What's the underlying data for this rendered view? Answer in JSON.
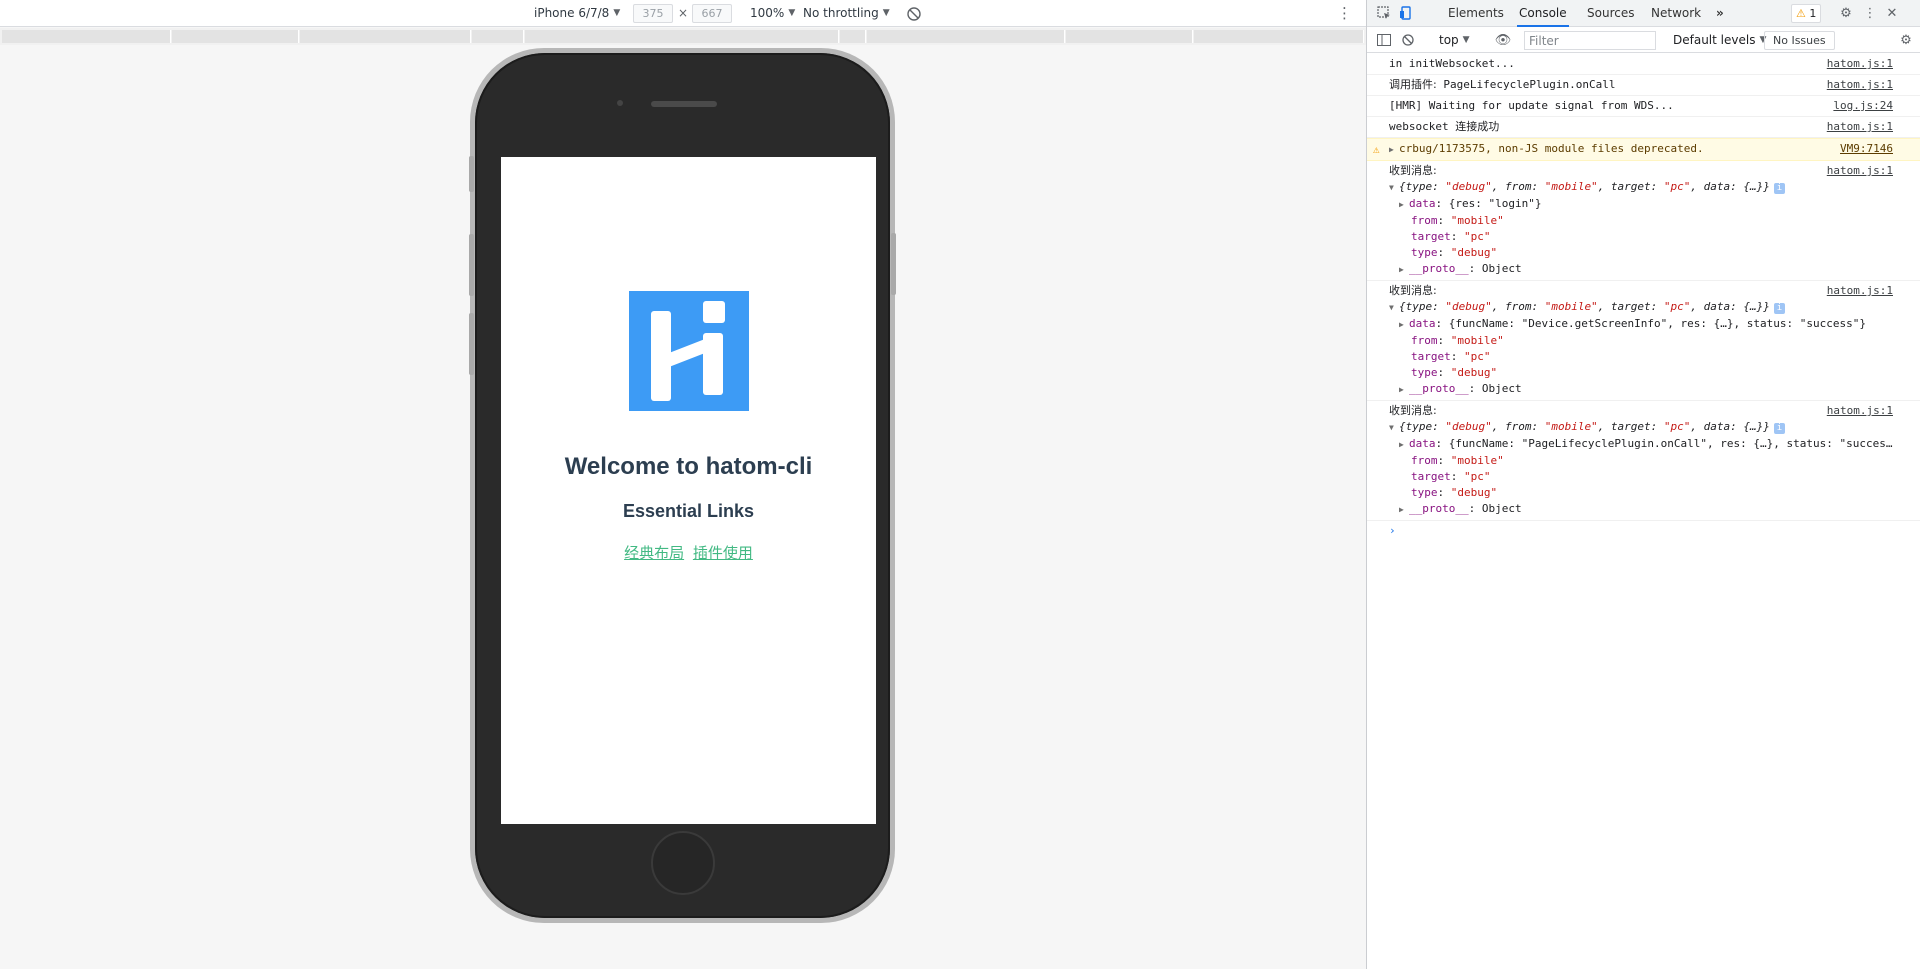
{
  "device_toolbar": {
    "device": "iPhone 6/7/8",
    "width": "375",
    "times": "×",
    "height": "667",
    "zoom": "100%",
    "throttling": "No throttling",
    "more": "⋮"
  },
  "app": {
    "title": "Welcome to hatom-cli",
    "subtitle": "Essential Links",
    "links": [
      "经典布局",
      "插件使用"
    ]
  },
  "devtools": {
    "tabs": [
      "Elements",
      "Console",
      "Sources",
      "Network"
    ],
    "active_tab": "Console",
    "more_tabs": "»",
    "warnings_count": "1",
    "context": "top",
    "filter_placeholder": "Filter",
    "levels": "Default levels",
    "issues": "No Issues"
  },
  "console": {
    "plain_logs": [
      {
        "text": "in initWebsocket...",
        "source": "hatom.js:1"
      },
      {
        "label": "调用插件:",
        "text": " PageLifecyclePlugin.onCall",
        "source": "hatom.js:1"
      },
      {
        "text": "[HMR] Waiting for update signal from WDS...",
        "source": "log.js:24"
      },
      {
        "text": "websocket ",
        "label": "连接成功",
        "source": "hatom.js:1"
      }
    ],
    "warning": {
      "text": "crbug/1173575, non-JS module files deprecated.",
      "source": "VM9:7146"
    },
    "received_label": "收到消息:",
    "messages": [
      {
        "source": "hatom.js:1",
        "summary_type": "\"debug\"",
        "summary_from": "\"mobile\"",
        "summary_target": "\"pc\"",
        "data_preview": "{res: \"login\"}",
        "from": "\"mobile\"",
        "target": "\"pc\"",
        "type": "\"debug\"",
        "proto": "Object"
      },
      {
        "source": "hatom.js:1",
        "summary_type": "\"debug\"",
        "summary_from": "\"mobile\"",
        "summary_target": "\"pc\"",
        "data_preview": "{funcName: \"Device.getScreenInfo\", res: {…}, status: \"success\"}",
        "from": "\"mobile\"",
        "target": "\"pc\"",
        "type": "\"debug\"",
        "proto": "Object"
      },
      {
        "source": "hatom.js:1",
        "summary_type": "\"debug\"",
        "summary_from": "\"mobile\"",
        "summary_target": "\"pc\"",
        "data_preview": "{funcName: \"PageLifecyclePlugin.onCall\", res: {…}, status: \"succes…",
        "from": "\"mobile\"",
        "target": "\"pc\"",
        "type": "\"debug\"",
        "proto": "Object"
      }
    ],
    "prompt": "›"
  }
}
